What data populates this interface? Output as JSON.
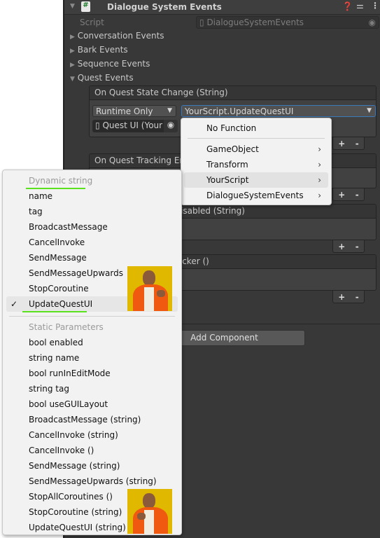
{
  "component": {
    "title": "Dialogue System Events",
    "script_label": "Script",
    "script_value": "DialogueSystemEvents"
  },
  "foldouts": [
    {
      "label": "Conversation Events",
      "expanded": false
    },
    {
      "label": "Bark Events",
      "expanded": false
    },
    {
      "label": "Sequence Events",
      "expanded": false
    },
    {
      "label": "Quest Events",
      "expanded": true
    }
  ],
  "events": [
    {
      "title": "On Quest State Change (String)",
      "runtime": "Runtime Only",
      "function": "YourScript.UpdateQuestUI",
      "object": "Quest UI (Your"
    },
    {
      "title": "On Quest Tracking Enabled (String)"
    },
    {
      "title": "On Quest Tracking Disabled (String)"
    },
    {
      "title": "On Update Quest Tracker ()"
    }
  ],
  "plus": "+",
  "minus": "-",
  "add_component": "Add Component",
  "function_menu": {
    "items": [
      "No Function",
      "GameObject",
      "Transform",
      "YourScript",
      "DialogueSystemEvents"
    ],
    "hovered": "YourScript"
  },
  "method_menu": {
    "dynamic_header": "Dynamic string",
    "dynamic": [
      "name",
      "tag",
      "BroadcastMessage",
      "CancelInvoke",
      "SendMessage",
      "SendMessageUpwards",
      "StopCoroutine",
      "UpdateQuestUI"
    ],
    "checked": "UpdateQuestUI",
    "check": "✓",
    "static_header": "Static Parameters",
    "static": [
      "bool enabled",
      "string name",
      "bool runInEditMode",
      "string tag",
      "bool useGUILayout",
      "BroadcastMessage (string)",
      "CancelInvoke (string)",
      "CancelInvoke ()",
      "SendMessage (string)",
      "SendMessageUpwards (string)",
      "StopAllCoroutines ()",
      "StopCoroutine (string)",
      "UpdateQuestUI (string)"
    ]
  },
  "colors": {
    "highlight": "#5be21e",
    "meme_bg": "#e0b800",
    "meme_jacket": "#f05a10"
  }
}
